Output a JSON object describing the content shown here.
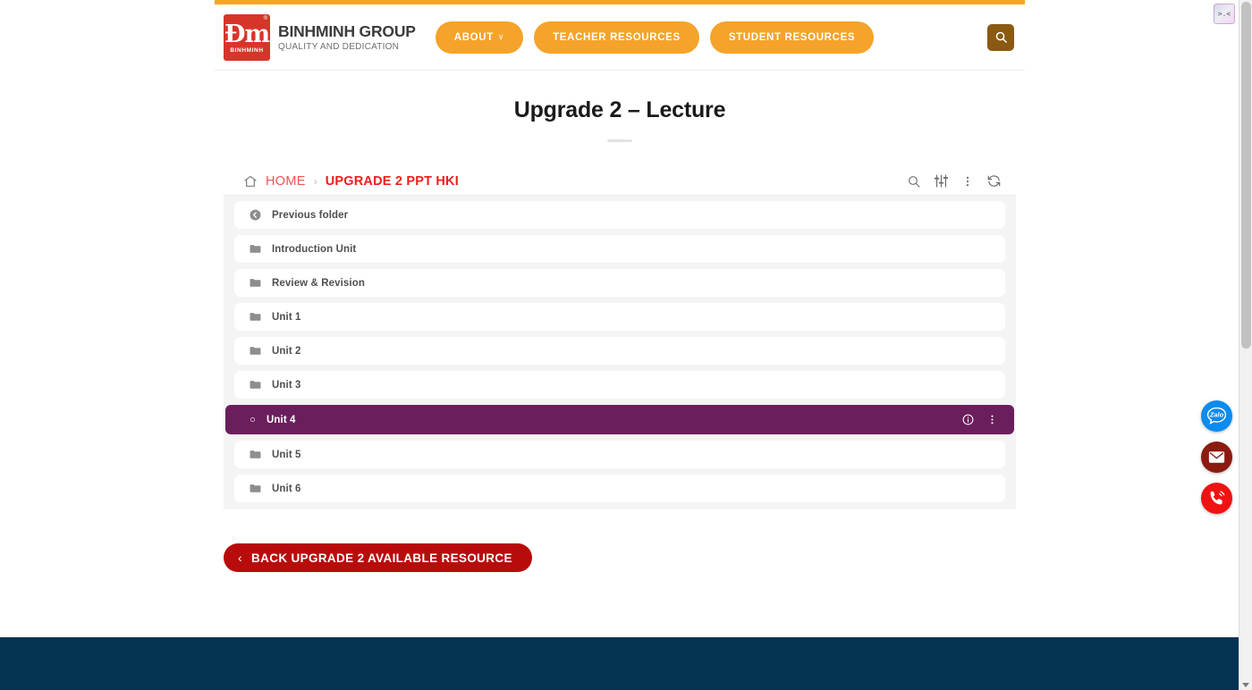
{
  "browser": {
    "scrollbar": {
      "name": "vertical-scrollbar"
    },
    "extension_widget_label": ">.<"
  },
  "header": {
    "logo": {
      "mark_glyph": "Đm",
      "mark_sub": "BINHMINH",
      "registered": "®",
      "name": "BINHMINH GROUP",
      "tagline": "QUALITY AND DEDICATION"
    },
    "nav": [
      {
        "label": "ABOUT",
        "has_caret": true,
        "caret": "∨"
      },
      {
        "label": "TEACHER RESOURCES",
        "has_caret": false
      },
      {
        "label": "STUDENT RESOURCES",
        "has_caret": false
      }
    ],
    "search_button": {
      "icon": "search-icon",
      "label": "Search"
    },
    "accent_bar_color": "#f5a623",
    "nav_button_color": "#f5a32a",
    "search_button_color": "#8a5a12"
  },
  "main": {
    "title": "Upgrade 2 – Lecture"
  },
  "filemanager": {
    "breadcrumb": {
      "home_icon": "home-icon",
      "home_label": "HOME",
      "separator": "›",
      "current": "UPGRADE 2 PPT HKI"
    },
    "tools": [
      {
        "name": "search-icon",
        "label": "Search"
      },
      {
        "name": "filter-sliders-icon",
        "label": "Filter"
      },
      {
        "name": "more-vertical-icon",
        "label": "More options"
      },
      {
        "name": "refresh-icon",
        "label": "Refresh"
      }
    ],
    "rows": [
      {
        "label": "Previous folder",
        "icon": "back-circle-icon",
        "type": "up",
        "selected": false
      },
      {
        "label": "Introduction Unit",
        "icon": "folder-icon",
        "type": "folder",
        "selected": false
      },
      {
        "label": "Review & Revision",
        "icon": "folder-icon",
        "type": "folder",
        "selected": false
      },
      {
        "label": "Unit 1",
        "icon": "folder-icon",
        "type": "folder",
        "selected": false
      },
      {
        "label": "Unit 2",
        "icon": "folder-icon",
        "type": "folder",
        "selected": false
      },
      {
        "label": "Unit 3",
        "icon": "folder-icon",
        "type": "folder",
        "selected": false
      },
      {
        "label": "Unit 4",
        "icon": "radio-circle-icon",
        "type": "folder",
        "selected": true
      },
      {
        "label": "Unit 5",
        "icon": "folder-icon",
        "type": "folder",
        "selected": false
      },
      {
        "label": "Unit 6",
        "icon": "folder-icon",
        "type": "folder",
        "selected": false
      }
    ],
    "selected_row_actions": [
      {
        "name": "info-icon",
        "label": "Details"
      },
      {
        "name": "more-vertical-icon",
        "label": "More options"
      }
    ],
    "selected_row_color": "#6b1e5c"
  },
  "back_button": {
    "chevron": "‹",
    "label": "BACK UPGRADE 2 AVAILABLE RESOURCE",
    "color": "#b80c0c"
  },
  "floating_buttons": [
    {
      "name": "zalo-chat-button",
      "label": "Zalo",
      "color": "#0c8bf0"
    },
    {
      "name": "email-button",
      "label": "Email",
      "color": "#8c1a11"
    },
    {
      "name": "phone-call-button",
      "label": "Call",
      "color": "#f01212"
    }
  ],
  "footer": {
    "color": "#053354"
  }
}
